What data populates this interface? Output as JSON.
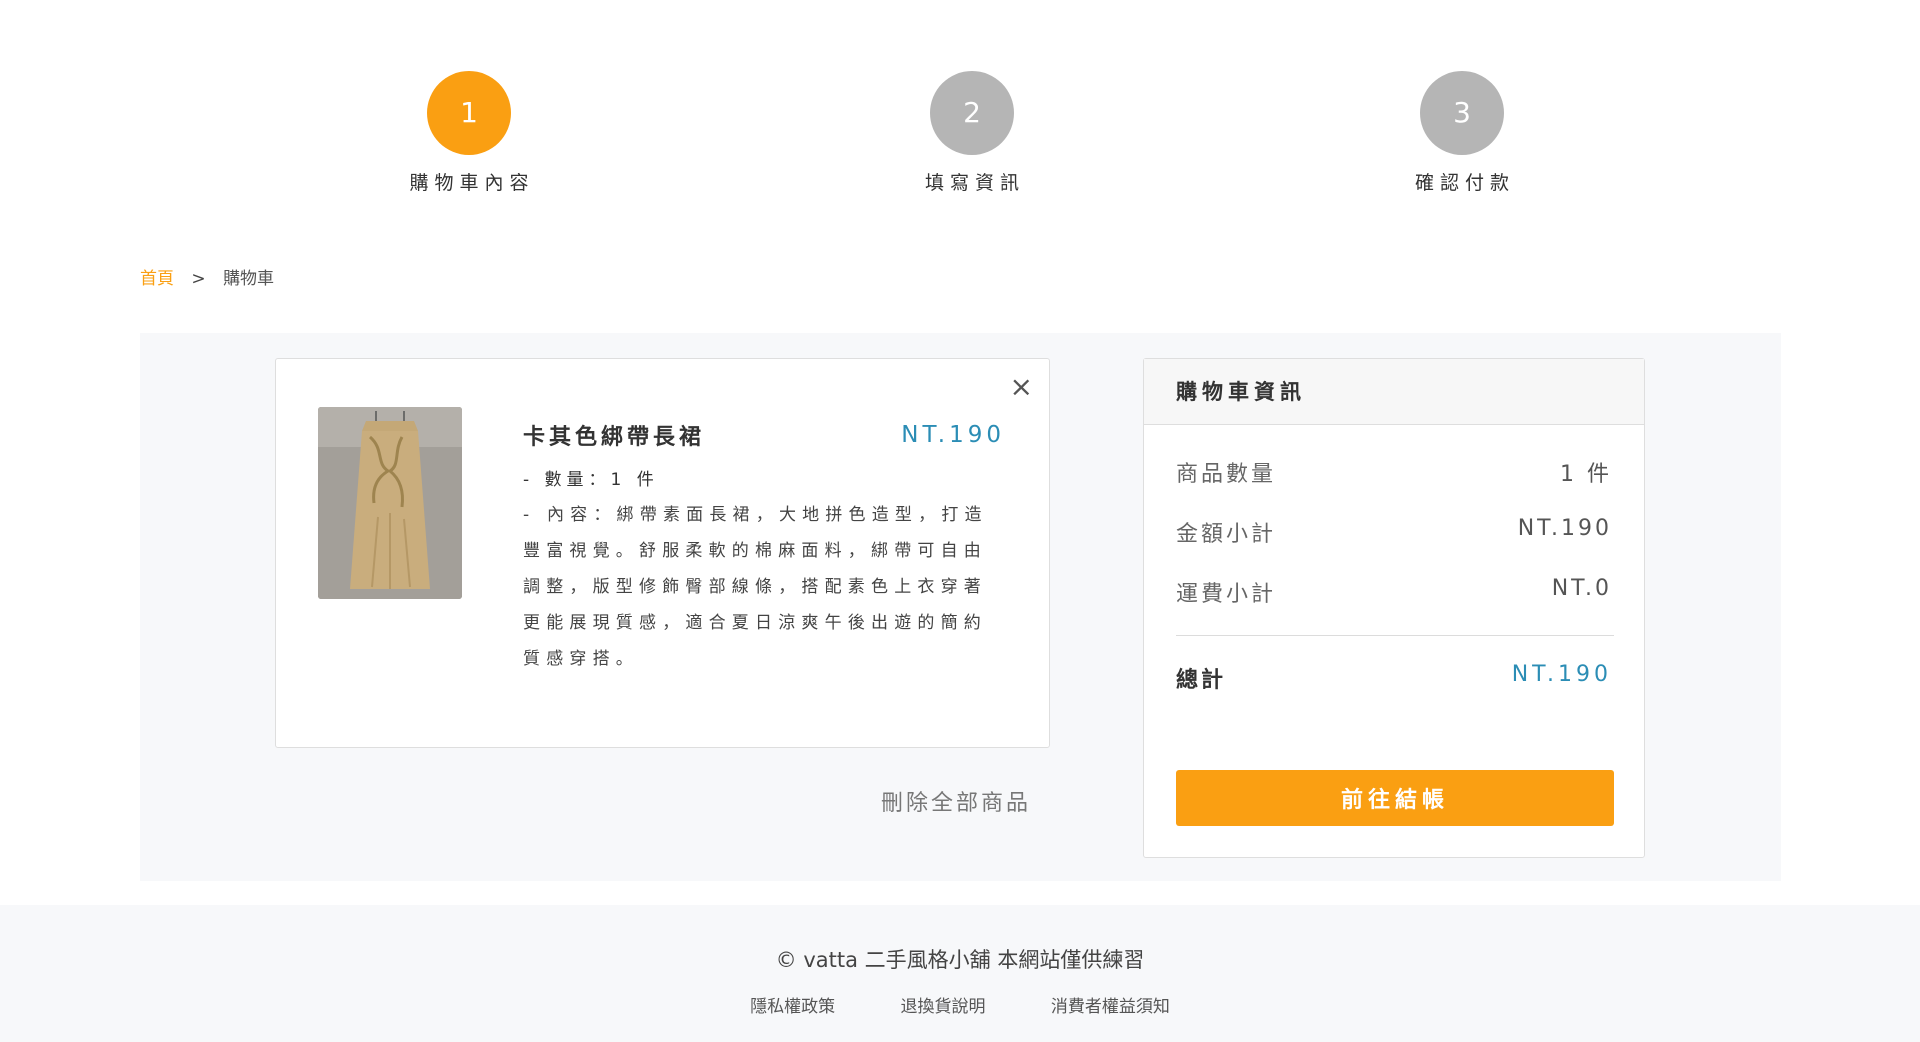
{
  "steps": [
    {
      "number": "1",
      "label": "購物車內容",
      "state": "active"
    },
    {
      "number": "2",
      "label": "填寫資訊",
      "state": "inactive"
    },
    {
      "number": "3",
      "label": "確認付款",
      "state": "inactive"
    }
  ],
  "breadcrumb": {
    "home": "首頁",
    "separator": ">",
    "current": "購物車"
  },
  "cart": {
    "items": [
      {
        "name": "卡其色綁帶長裙",
        "price": "NT.190",
        "quantity": "- 數量：1 件",
        "description": "- 內容：綁帶素面長裙，大地拼色造型，打造豐富視覺。舒服柔軟的棉麻面料，綁帶可自由調整，版型修飾臀部線條，搭配素色上衣穿著更能展現質感，適合夏日涼爽午後出遊的簡約質感穿搭。",
        "close_icon": "×"
      }
    ],
    "delete_all_label": "刪除全部商品"
  },
  "summary": {
    "title": "購物車資訊",
    "rows": [
      {
        "label": "商品數量",
        "value": "1 件"
      },
      {
        "label": "金額小計",
        "value": "NT.190"
      },
      {
        "label": "運費小計",
        "value": "NT.0"
      }
    ],
    "total_label": "總計",
    "total_value": "NT.190",
    "checkout_label": "前往結帳"
  },
  "footer": {
    "copyright": "© vatta 二手風格小舖 本網站僅供練習",
    "links": [
      "隱私權政策",
      "退換貨說明",
      "消費者權益須知"
    ]
  },
  "colors": {
    "accent": "#fa9f12",
    "price": "#2b8db5",
    "step_inactive": "#b5b5b5"
  }
}
